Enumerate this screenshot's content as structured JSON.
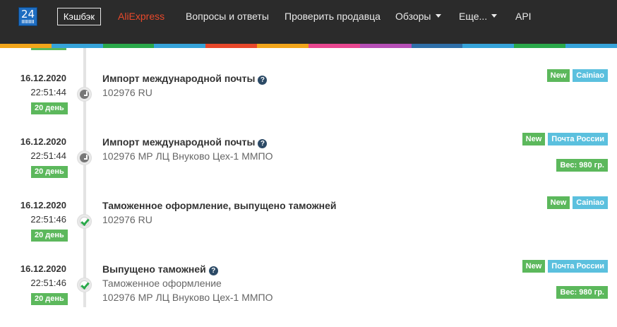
{
  "navbar": {
    "logo_text": "24",
    "cashback_label": "Кэшбэк",
    "items": [
      {
        "label": "AliExpress"
      },
      {
        "label": "Вопросы и ответы"
      },
      {
        "label": "Проверить продавца"
      },
      {
        "label": "Обзоры"
      },
      {
        "label": "Еще..."
      },
      {
        "label": "API"
      }
    ],
    "strip_colors": [
      "#f2a51a",
      "#36a3d9",
      "#2aa84a",
      "#36a3d9",
      "#e8482b",
      "#f2a51a",
      "#e94790",
      "#b64fb6",
      "#2f6fa8",
      "#36a3d9",
      "#2aa84a",
      "#36a3d9"
    ]
  },
  "events": [
    {
      "date": "16.12.2020",
      "time": "22:51:44",
      "day": "20 день",
      "icon": "clock-icon",
      "title": "Импорт международной почты",
      "has_help": true,
      "lines": [
        "102976 RU"
      ],
      "badges": [
        "New",
        "Cainiao"
      ],
      "weight": ""
    },
    {
      "date": "16.12.2020",
      "time": "22:51:44",
      "day": "20 день",
      "icon": "clock-icon",
      "title": "Импорт международной почты",
      "has_help": true,
      "lines": [
        "102976 МР ЛЦ Внуково Цех-1 ММПО"
      ],
      "badges": [
        "New",
        "Почта России"
      ],
      "weight": "Вес: 980 гр."
    },
    {
      "date": "16.12.2020",
      "time": "22:51:46",
      "day": "20 день",
      "icon": "check-icon",
      "title": "Таможенное оформление, выпущено таможней",
      "has_help": false,
      "lines": [
        "102976 RU"
      ],
      "badges": [
        "New",
        "Cainiao"
      ],
      "weight": ""
    },
    {
      "date": "16.12.2020",
      "time": "22:51:46",
      "day": "20 день",
      "icon": "check-icon",
      "title": "Выпущено таможней",
      "has_help": true,
      "lines": [
        "Таможенное оформление",
        "102976 МР ЛЦ Внуково Цех-1 ММПО"
      ],
      "badges": [
        "New",
        "Почта России"
      ],
      "weight": "Вес: 980 гр."
    }
  ],
  "help_glyph": "?"
}
